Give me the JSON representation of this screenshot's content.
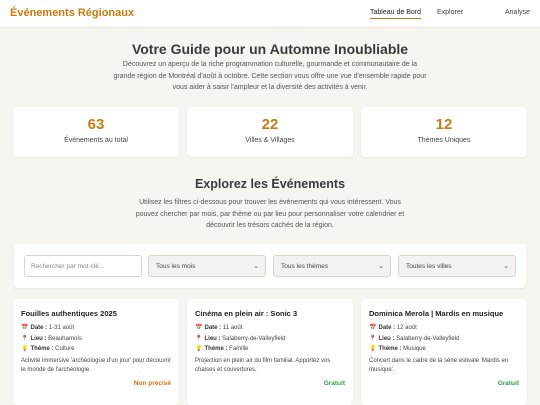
{
  "nav": {
    "brand": "Événements Régionaux",
    "links": [
      "Tableau de Bord",
      "Explorer",
      "Analyse"
    ]
  },
  "hero": {
    "title": "Votre Guide pour un Automne Inoubliable",
    "intro": "Découvrez un aperçu de la riche programmation culturelle, gourmande et communautaire de la grande région de Montréal d'août à octobre. Cette section vous offre une vue d'ensemble rapide pour vous aider à saisir l'ampleur et la diversité des activités à venir."
  },
  "stats": [
    {
      "value": "63",
      "label": "Événements au total"
    },
    {
      "value": "22",
      "label": "Villes & Villages"
    },
    {
      "value": "12",
      "label": "Thèmes Uniques"
    }
  ],
  "explore": {
    "title": "Explorez les Événements",
    "intro": "Utilisez les filtres ci-dessous pour trouver les événements qui vous intéressent. Vous pouvez chercher par mois, par thème ou par lieu pour personnaliser votre calendrier et découvrir les trésors cachés de la région."
  },
  "filters": {
    "search_placeholder": "Rechercher par mot-clé...",
    "month": "Tous les mois",
    "theme": "Tous les thèmes",
    "city": "Toutes les villes"
  },
  "meta_labels": {
    "date": "Date :",
    "place": "Lieu :",
    "theme": "Thème :"
  },
  "icons": {
    "date": "calendar-icon",
    "place": "pin-icon",
    "theme": "lightbulb-icon",
    "chevron": "chevron-down-icon"
  },
  "colors": {
    "accent": "#c97a12",
    "free": "#2e9b47",
    "unspecified": "#d9730d"
  },
  "events": [
    {
      "title": "Fouilles authentiques 2025",
      "date": "1-31 août",
      "place": "Beauharnois",
      "theme": "Culture",
      "desc": "Activité immersive 'archéologue d'un jour' pour découvrir le monde de l'archéologie.",
      "price": "Non précisé"
    },
    {
      "title": "Cinéma en plein air : Sonic 3",
      "date": "11 août",
      "place": "Salaberry-de-Valleyfield",
      "theme": "Famille",
      "desc": "Projection en plein air du film familial. Apportez vos chaises et couvertures.",
      "price": "Gratuit"
    },
    {
      "title": "Dominica Merola | Mardis en musique",
      "date": "12 août",
      "place": "Salaberry-de-Valleyfield",
      "theme": "Musique",
      "desc": "Concert dans le cadre de la série estivale 'Mardis en musique'.",
      "price": "Gratuit"
    }
  ]
}
